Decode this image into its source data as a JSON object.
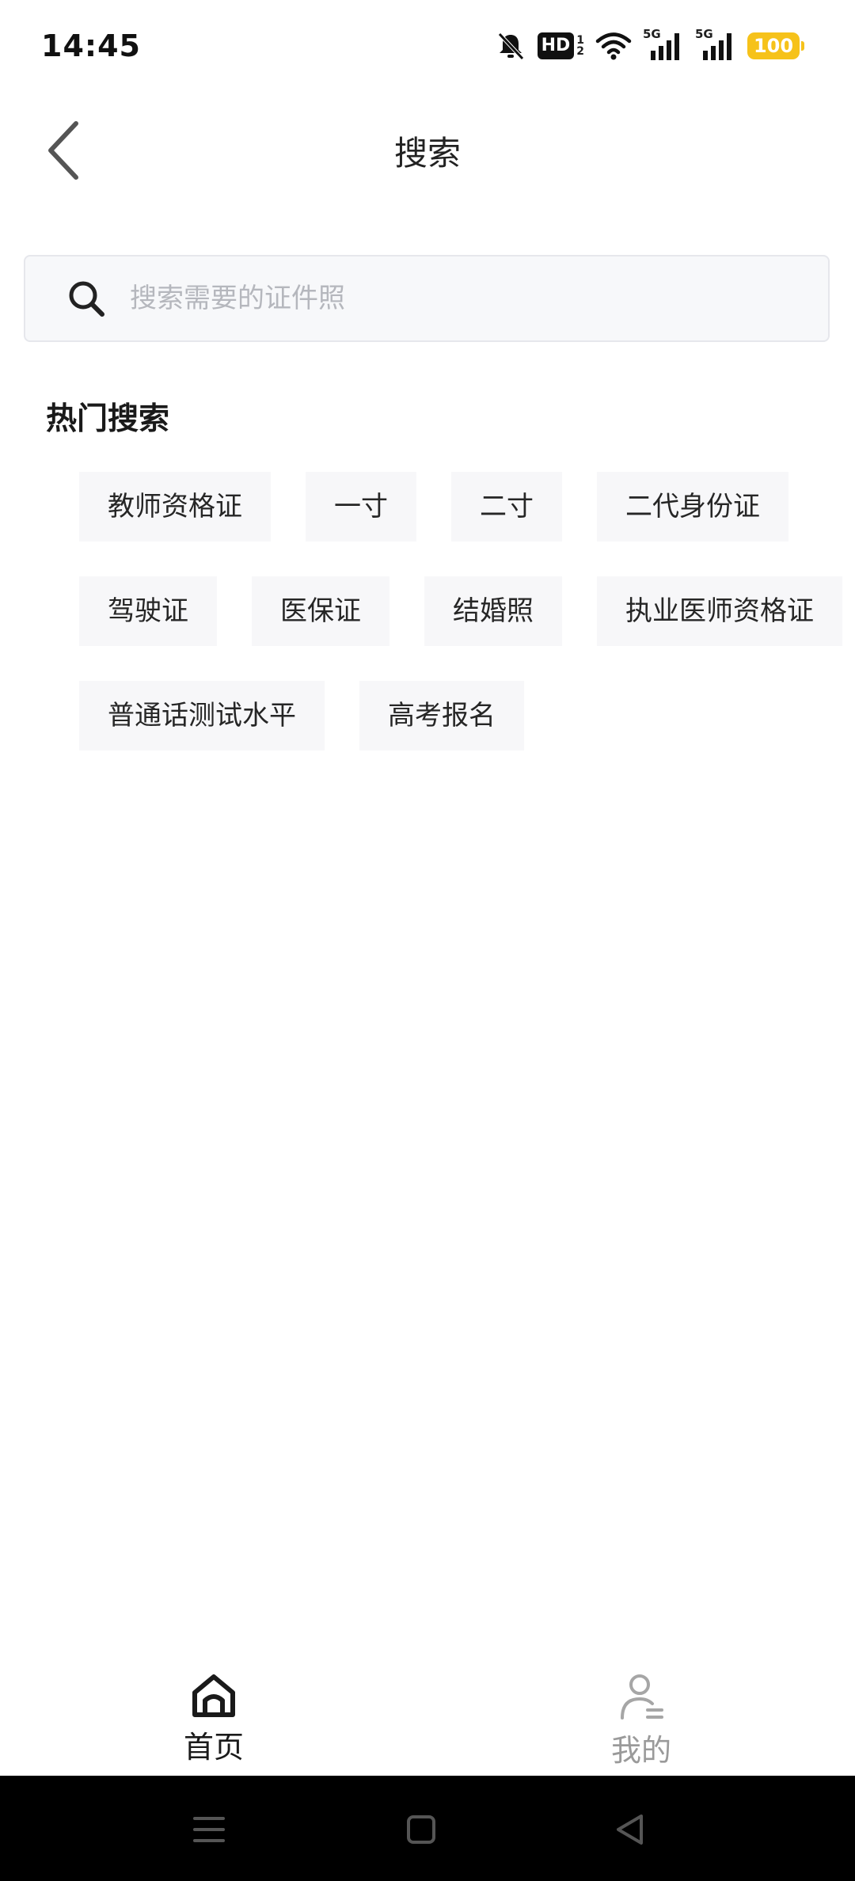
{
  "status_bar": {
    "time": "14:45",
    "hd_label": "HD",
    "hd_sub_top": "1",
    "hd_sub_bottom": "2",
    "signal1_label": "5G",
    "signal2_label": "5G",
    "battery": "100",
    "icons": [
      "bell-muted-icon",
      "hd-icon",
      "wifi-icon",
      "signal-5g-icon",
      "signal-5g-icon",
      "battery-icon"
    ],
    "battery_color": "#f6c21a"
  },
  "nav": {
    "title": "搜索",
    "back_icon": "chevron-left-icon"
  },
  "search": {
    "placeholder": "搜索需要的证件照",
    "value": ""
  },
  "hot_search": {
    "title": "热门搜索",
    "rows": [
      [
        "教师资格证",
        "一寸",
        "二寸",
        "二代身份证"
      ],
      [
        "驾驶证",
        "医保证",
        "结婚照",
        "执业医师资格证"
      ],
      [
        "普通话测试水平",
        "高考报名"
      ]
    ]
  },
  "tab_bar": {
    "tabs": [
      {
        "label": "首页",
        "icon": "home-icon",
        "active": true
      },
      {
        "label": "我的",
        "icon": "user-icon",
        "active": false
      }
    ]
  },
  "system_nav": {
    "icons": [
      "menu-icon",
      "square-home-icon",
      "triangle-back-icon"
    ]
  },
  "colors": {
    "tag_bg": "#f7f7f9",
    "active_tab": "#1a1a1a",
    "inactive_tab": "#9a9a9a"
  }
}
